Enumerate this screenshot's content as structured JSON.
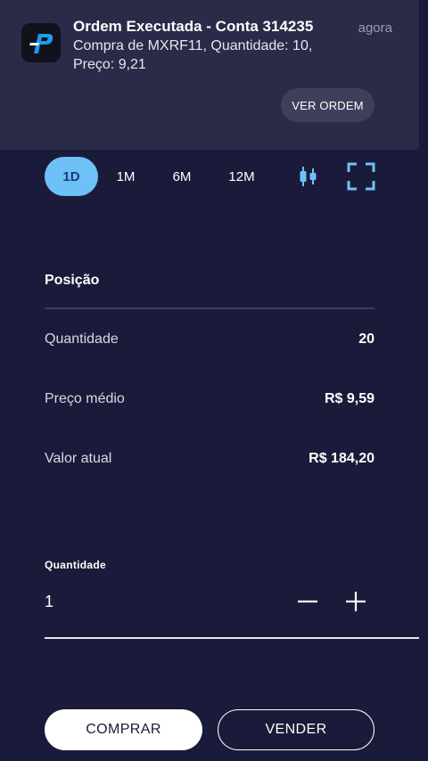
{
  "notification": {
    "app_icon": "app-logo-icon",
    "title": "Ordem Executada - Conta 314235",
    "body": "Compra de MXRF11, Quantidade: 10, Preço: 9,21",
    "time": "agora",
    "action_label": "VER ORDEM"
  },
  "tabs": [
    {
      "label": "1D",
      "active": true
    },
    {
      "label": "1M",
      "active": false
    },
    {
      "label": "6M",
      "active": false
    },
    {
      "label": "12M",
      "active": false
    }
  ],
  "toolbar": {
    "chart_toggle_icon": "candlestick-icon",
    "expand_icon": "fullscreen-icon"
  },
  "position": {
    "title": "Posição",
    "rows": [
      {
        "label": "Quantidade",
        "value": "20"
      },
      {
        "label": "Preço médio",
        "value": "R$ 9,59"
      },
      {
        "label": "Valor atual",
        "value": "R$ 184,20"
      }
    ]
  },
  "order": {
    "quantity_label": "Quantidade",
    "quantity_value": "1",
    "minus_icon": "minus-icon",
    "plus_icon": "plus-icon"
  },
  "actions": {
    "buy_label": "COMPRAR",
    "sell_label": "VENDER"
  },
  "colors": {
    "background": "#1a1b3a",
    "accent": "#6ec1f7",
    "notification_bg": "#2a2b48"
  }
}
